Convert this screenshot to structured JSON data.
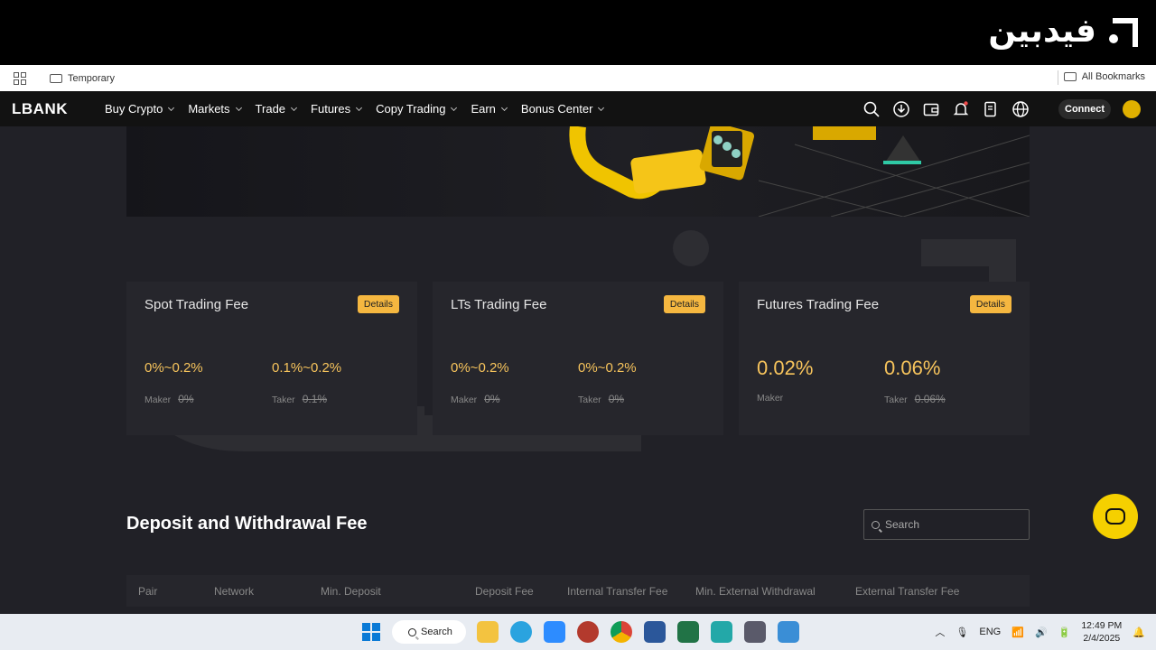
{
  "overlay": {
    "logo_text": "فیدبین"
  },
  "bookmarks": {
    "folder_label": "Temporary",
    "all_label": "All Bookmarks"
  },
  "nav": {
    "brand": "LBANK",
    "items": [
      "Buy Crypto",
      "Markets",
      "Trade",
      "Futures",
      "Copy Trading",
      "Earn",
      "Bonus Center"
    ],
    "connect_label": "Connect"
  },
  "fees": {
    "details_label": "Details",
    "maker_label": "Maker",
    "taker_label": "Taker",
    "cards": [
      {
        "title": "Spot Trading Fee",
        "maker_value": "0%~0.2%",
        "maker_old": "0%",
        "taker_value": "0.1%~0.2%",
        "taker_old": "0.1%"
      },
      {
        "title": "LTs Trading Fee",
        "maker_value": "0%~0.2%",
        "maker_old": "0%",
        "taker_value": "0%~0.2%",
        "taker_old": "0%"
      },
      {
        "title": "Futures Trading Fee",
        "maker_value": "0.02%",
        "maker_old": "",
        "taker_value": "0.06%",
        "taker_old": "0.06%"
      }
    ]
  },
  "deposit": {
    "title": "Deposit and Withdrawal Fee",
    "search_placeholder": "Search",
    "columns": [
      "Pair",
      "Network",
      "Min. Deposit",
      "Deposit Fee",
      "Internal Transfer Fee",
      "Min. External Withdrawal",
      "External Transfer Fee"
    ]
  },
  "taskbar": {
    "search_label": "Search",
    "lang": "ENG",
    "time": "12:49 PM",
    "date": "2/4/2025"
  },
  "colors": {
    "accent": "#f5b740",
    "fee_value": "#f7c45c",
    "page_bg": "#212127",
    "nav_bg": "#121212"
  }
}
